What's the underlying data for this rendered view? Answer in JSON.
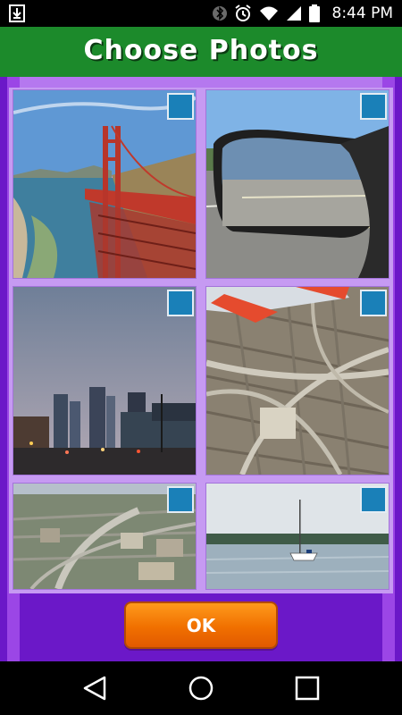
{
  "status_bar": {
    "time": "8:44 PM",
    "icons": [
      "download-icon",
      "bluetooth-icon",
      "alarm-icon",
      "wifi-icon",
      "signal-icon",
      "battery-icon"
    ]
  },
  "header": {
    "title": "Choose Photos",
    "color": "#1c8a2b"
  },
  "photos": [
    {
      "subject": "golden-gate-bridge",
      "selected": false
    },
    {
      "subject": "car-side-mirror-road",
      "selected": false
    },
    {
      "subject": "city-skyline-dusk",
      "selected": false
    },
    {
      "subject": "aerial-highway-interchange",
      "selected": false
    },
    {
      "subject": "aerial-city-highway",
      "selected": false
    },
    {
      "subject": "sailboat-on-lake",
      "selected": false
    }
  ],
  "ok_button": {
    "label": "OK",
    "color": "#f07000"
  },
  "nav_bar": {
    "icons": [
      "back-icon",
      "home-icon",
      "recents-icon"
    ]
  },
  "colors": {
    "background": "#6b18c8",
    "checkbox": "#1a80b8"
  }
}
